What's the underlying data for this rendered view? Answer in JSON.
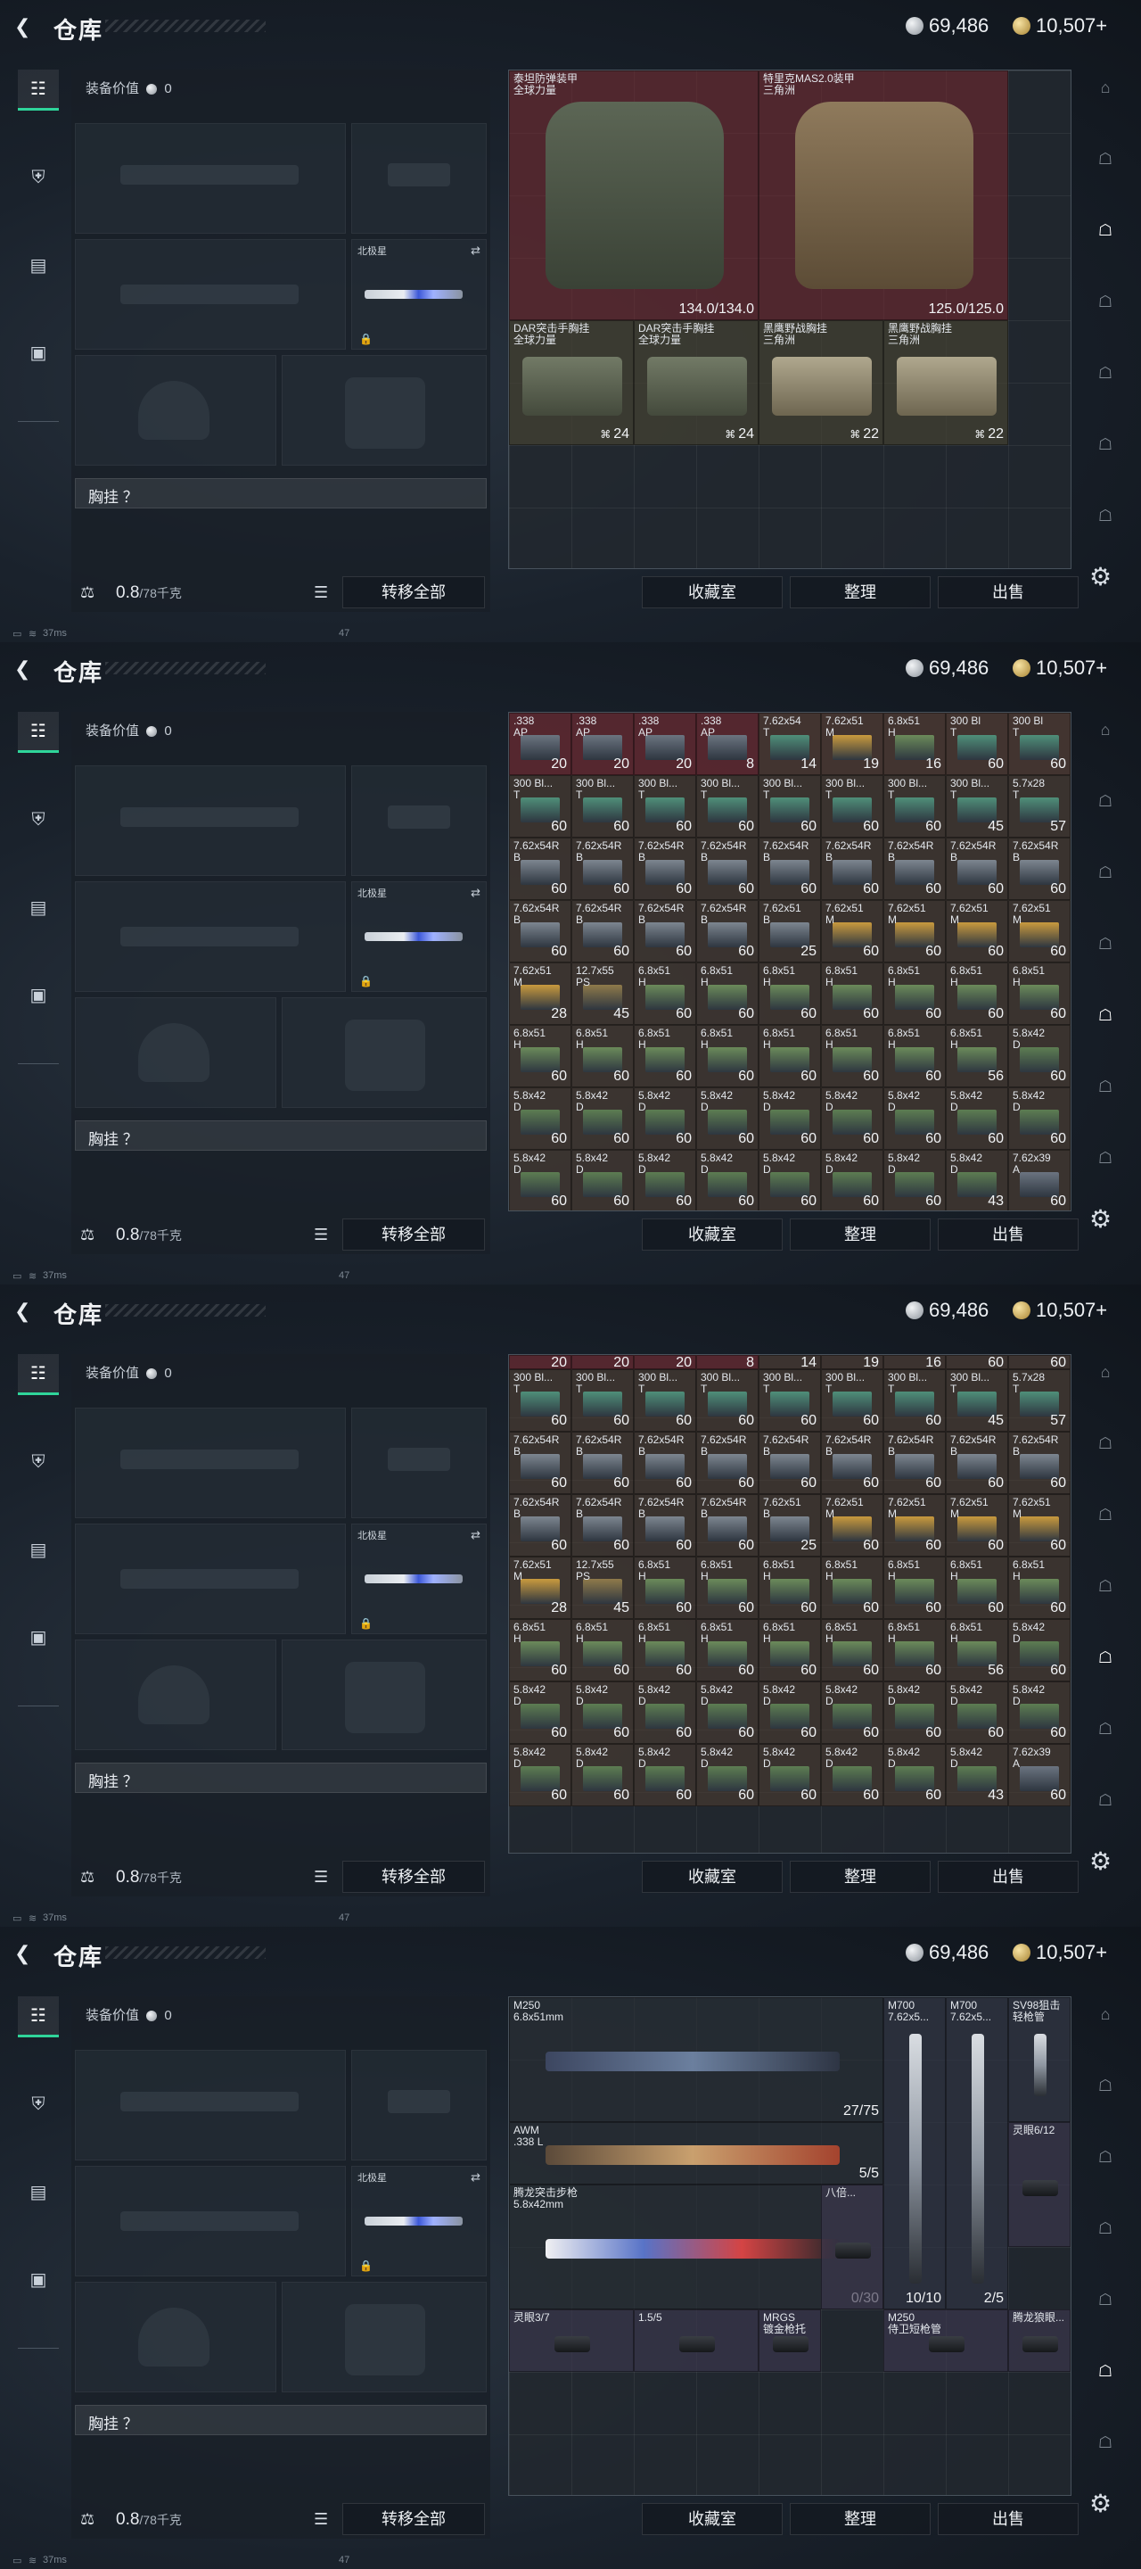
{
  "header": {
    "title": "仓库",
    "silver": "69,486",
    "gold": "10,507+"
  },
  "loadout": {
    "value_label": "装备价值",
    "value": "0",
    "knife_label": "北极星",
    "chest_label": "胸挂 ？",
    "weight_value": "0.8",
    "weight_capacity": "/78千克",
    "transfer_all": "转移全部"
  },
  "actions": {
    "favorites": "收藏室",
    "organize": "整理",
    "sell": "出售"
  },
  "status": {
    "ping": "37ms",
    "num": "47"
  },
  "armor_panel": {
    "items": [
      {
        "name": "泰坦防弹装甲\n全球力量",
        "durability": "134.0/134.0"
      },
      {
        "name": "特里克MAS2.0装甲\n三角洲",
        "durability": "125.0/125.0"
      }
    ],
    "rigs": [
      {
        "name": "DAR突击手胸挂\n全球力量",
        "capacity": "24"
      },
      {
        "name": "DAR突击手胸挂\n全球力量",
        "capacity": "24"
      },
      {
        "name": "黑鹰野战胸挂\n三角洲",
        "capacity": "22"
      },
      {
        "name": "黑鹰野战胸挂\n三角洲",
        "capacity": "22"
      }
    ]
  },
  "ammo_panel": {
    "top_clip": [
      "20",
      "20",
      "20",
      "8",
      "14",
      "19",
      "16",
      "60",
      "60"
    ],
    "rows": [
      [
        [
          ".338\nAP",
          "20"
        ],
        [
          ".338\nAP",
          "20"
        ],
        [
          ".338\nAP",
          "20"
        ],
        [
          ".338\nAP",
          "8"
        ],
        [
          "7.62x54\nT",
          "14"
        ],
        [
          "7.62x51\nM",
          "19"
        ],
        [
          "6.8x51\nH",
          "16"
        ],
        [
          "300 Bl\nT",
          "60"
        ],
        [
          "300 Bl\nT",
          "60"
        ]
      ],
      [
        [
          "300 Bl...\nT",
          "60"
        ],
        [
          "300 Bl...\nT",
          "60"
        ],
        [
          "300 Bl...\nT",
          "60"
        ],
        [
          "300 Bl...\nT",
          "60"
        ],
        [
          "300 Bl...\nT",
          "60"
        ],
        [
          "300 Bl...\nT",
          "60"
        ],
        [
          "300 Bl...\nT",
          "60"
        ],
        [
          "300 Bl...\nT",
          "45"
        ],
        [
          "5.7x28\nT",
          "57"
        ]
      ],
      [
        [
          "7.62x54R\nB",
          "60"
        ],
        [
          "7.62x54R\nB",
          "60"
        ],
        [
          "7.62x54R\nB",
          "60"
        ],
        [
          "7.62x54R\nB",
          "60"
        ],
        [
          "7.62x54R\nB",
          "60"
        ],
        [
          "7.62x54R\nB",
          "60"
        ],
        [
          "7.62x54R\nB",
          "60"
        ],
        [
          "7.62x54R\nB",
          "60"
        ],
        [
          "7.62x54R\nB",
          "60"
        ]
      ],
      [
        [
          "7.62x54R\nB",
          "60"
        ],
        [
          "7.62x54R\nB",
          "60"
        ],
        [
          "7.62x54R\nB",
          "60"
        ],
        [
          "7.62x54R\nB",
          "60"
        ],
        [
          "7.62x51\nB",
          "25"
        ],
        [
          "7.62x51\nM",
          "60"
        ],
        [
          "7.62x51\nM",
          "60"
        ],
        [
          "7.62x51\nM",
          "60"
        ],
        [
          "7.62x51\nM",
          "60"
        ]
      ],
      [
        [
          "7.62x51\nM",
          "28"
        ],
        [
          "12.7x55\nPS",
          "45"
        ],
        [
          "6.8x51\nH",
          "60"
        ],
        [
          "6.8x51\nH",
          "60"
        ],
        [
          "6.8x51\nH",
          "60"
        ],
        [
          "6.8x51\nH",
          "60"
        ],
        [
          "6.8x51\nH",
          "60"
        ],
        [
          "6.8x51\nH",
          "60"
        ],
        [
          "6.8x51\nH",
          "60"
        ]
      ],
      [
        [
          "6.8x51\nH",
          "60"
        ],
        [
          "6.8x51\nH",
          "60"
        ],
        [
          "6.8x51\nH",
          "60"
        ],
        [
          "6.8x51\nH",
          "60"
        ],
        [
          "6.8x51\nH",
          "60"
        ],
        [
          "6.8x51\nH",
          "60"
        ],
        [
          "6.8x51\nH",
          "60"
        ],
        [
          "6.8x51\nH",
          "56"
        ],
        [
          "5.8x42\nD",
          "60"
        ]
      ],
      [
        [
          "5.8x42\nD",
          "60"
        ],
        [
          "5.8x42\nD",
          "60"
        ],
        [
          "5.8x42\nD",
          "60"
        ],
        [
          "5.8x42\nD",
          "60"
        ],
        [
          "5.8x42\nD",
          "60"
        ],
        [
          "5.8x42\nD",
          "60"
        ],
        [
          "5.8x42\nD",
          "60"
        ],
        [
          "5.8x42\nD",
          "60"
        ],
        [
          "5.8x42\nD",
          "60"
        ]
      ],
      [
        [
          "5.8x42\nD",
          "60"
        ],
        [
          "5.8x42\nD",
          "60"
        ],
        [
          "5.8x42\nD",
          "60"
        ],
        [
          "5.8x42\nD",
          "60"
        ],
        [
          "5.8x42\nD",
          "60"
        ],
        [
          "5.8x42\nD",
          "60"
        ],
        [
          "5.8x42\nD",
          "60"
        ],
        [
          "5.8x42\nD",
          "43"
        ],
        [
          "7.62x39\nA",
          "60"
        ]
      ]
    ]
  },
  "weapon_panel": {
    "large": [
      {
        "name": "M250\n6.8x51mm",
        "ammo": "27/75"
      },
      {
        "name": "AWM\n.338 L",
        "ammo": "5/5"
      },
      {
        "name": "腾龙突击步枪\n5.8x42mm",
        "ammo": "0/30"
      }
    ],
    "tall": [
      {
        "name": "M700\n7.62x5...",
        "ammo": "10/10"
      },
      {
        "name": "M700\n7.62x5...",
        "ammo": "2/5"
      },
      {
        "name": "SV98狙击\n轻枪管",
        "ammo": ""
      }
    ],
    "small": [
      {
        "name": "八倍..."
      },
      {
        "name": "灵眼6/12"
      },
      {
        "name": "灵眼3/7"
      },
      {
        "name": "1.5/5"
      },
      {
        "name": "MRGS\n镀金枪托"
      },
      {
        "name": "M250\n侍卫短枪管"
      },
      {
        "name": "腾龙狼眼..."
      }
    ]
  }
}
